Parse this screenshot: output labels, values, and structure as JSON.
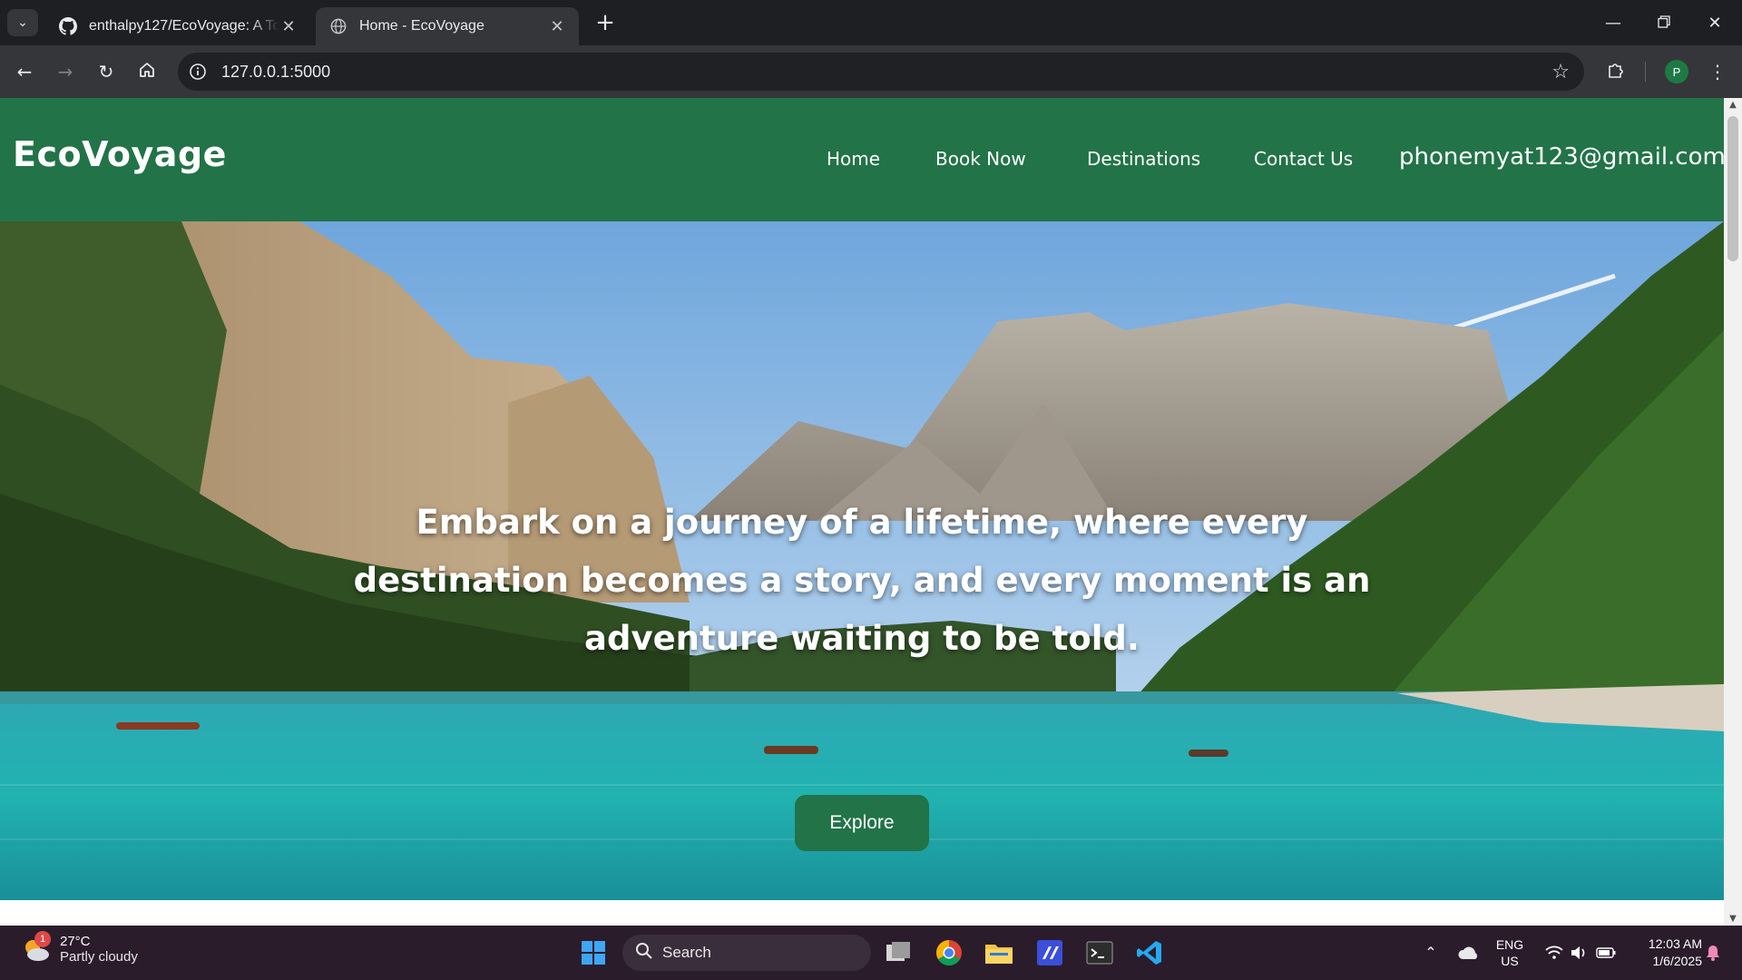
{
  "browser": {
    "tabs": [
      {
        "title": "enthalpy127/EcoVoyage: A Tour",
        "favicon": "github-icon",
        "active": false
      },
      {
        "title": "Home - EcoVoyage",
        "favicon": "globe-icon",
        "active": true
      }
    ],
    "url": "127.0.0.1:5000",
    "profile_initial": "P"
  },
  "site": {
    "brand": "EcoVoyage",
    "nav": {
      "home": "Home",
      "book": "Book Now",
      "destinations": "Destinations",
      "contact": "Contact Us",
      "email": "phonemyat123@gmail.com"
    },
    "hero": {
      "tagline": "Embark on a journey of a lifetime, where every destination becomes a story, and every moment is an adventure waiting to be told.",
      "button": "Explore"
    },
    "colors": {
      "primary": "#227348",
      "text": "#ffffff"
    }
  },
  "taskbar": {
    "weather": {
      "temp": "27°C",
      "condition": "Partly cloudy",
      "badge": "1"
    },
    "search_placeholder": "Search",
    "lang_top": "ENG",
    "lang_bottom": "US",
    "time": "12:03 AM",
    "date": "1/6/2025"
  }
}
